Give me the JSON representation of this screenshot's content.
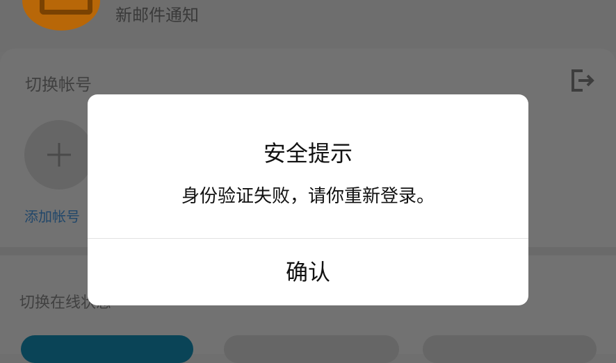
{
  "background": {
    "notification": {
      "text": "新邮件通知"
    },
    "account_sheet": {
      "title": "切换帐号",
      "add_account_label": "添加帐号",
      "online_section_title": "切换在线状态"
    }
  },
  "dialog": {
    "title": "安全提示",
    "message": "身份验证失败，请你重新登录。",
    "confirm_label": "确认"
  },
  "colors": {
    "overlay": "#6f6f6f",
    "dialog_bg": "#ffffff",
    "link_blue_dimmed": "#21476a",
    "teal_button_dimmed": "#0a4457"
  }
}
